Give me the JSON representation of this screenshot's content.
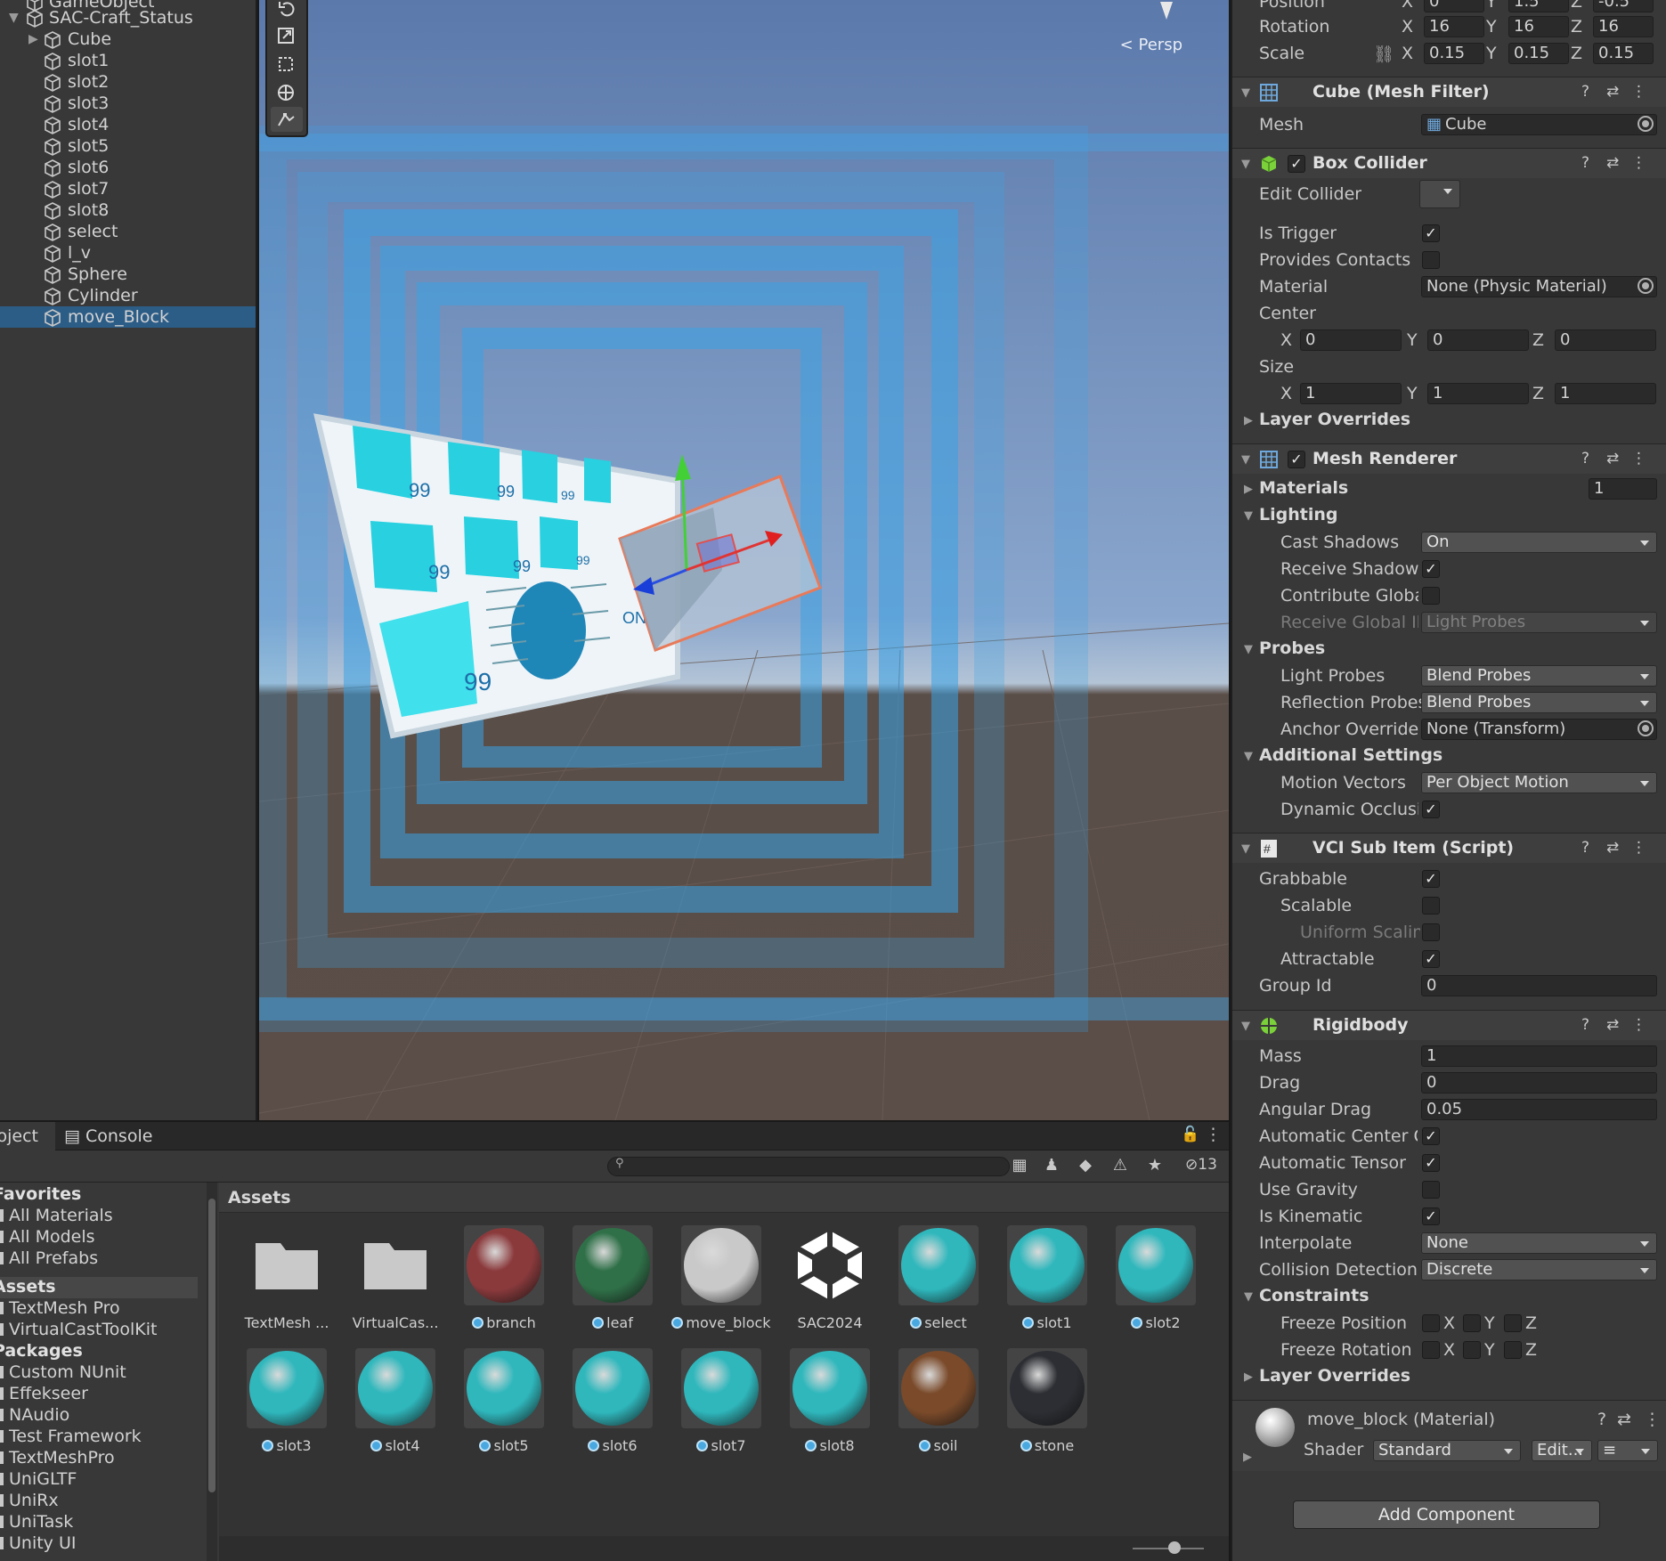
{
  "hierarchy": {
    "items": [
      {
        "label": "GameObject"
      },
      {
        "label": "SAC-Craft_Status"
      },
      {
        "label": "Cube"
      },
      {
        "label": "slot1"
      },
      {
        "label": "slot2"
      },
      {
        "label": "slot3"
      },
      {
        "label": "slot4"
      },
      {
        "label": "slot5"
      },
      {
        "label": "slot6"
      },
      {
        "label": "slot7"
      },
      {
        "label": "slot8"
      },
      {
        "label": "select"
      },
      {
        "label": "l_v"
      },
      {
        "label": "Sphere"
      },
      {
        "label": "Cylinder"
      },
      {
        "label": "move_Block"
      }
    ],
    "selected": "move_Block"
  },
  "scene": {
    "persp_label": "Persp",
    "panel_counts": [
      "99",
      "99",
      "99",
      "99",
      "99",
      "99",
      "99",
      "99",
      "99"
    ],
    "panel_switch": "ON"
  },
  "bottom": {
    "tabs": [
      {
        "label": "Project"
      },
      {
        "label": "Console"
      }
    ],
    "hidden_count": "13",
    "favorites": {
      "title": "Favorites",
      "items": [
        "All Materials",
        "All Models",
        "All Prefabs"
      ]
    },
    "assets_root": {
      "title": "Assets",
      "items": [
        "TextMesh Pro",
        "VirtualCastToolKit"
      ]
    },
    "packages": {
      "title": "Packages",
      "items": [
        "Custom NUnit",
        "Effekseer",
        "NAudio",
        "Test Framework",
        "TextMeshPro",
        "UniGLTF",
        "UniRx",
        "UniTask",
        "Unity UI"
      ]
    },
    "breadcrumb": "Assets",
    "assets": [
      {
        "label": "TextMesh ...",
        "kind": "folder"
      },
      {
        "label": "VirtualCas...",
        "kind": "folder"
      },
      {
        "label": "branch",
        "kind": "material",
        "color": "#8b3a3c"
      },
      {
        "label": "leaf",
        "kind": "material",
        "color": "#2f7048"
      },
      {
        "label": "move_block",
        "kind": "material",
        "color": "#c9c9c9"
      },
      {
        "label": "SAC2024",
        "kind": "unity"
      },
      {
        "label": "select",
        "kind": "material",
        "color": "#2fb7bc"
      },
      {
        "label": "slot1",
        "kind": "material",
        "color": "#2fb7bc"
      },
      {
        "label": "slot2",
        "kind": "material",
        "color": "#2fb7bc"
      },
      {
        "label": "slot3",
        "kind": "material",
        "color": "#2fb7bc"
      },
      {
        "label": "slot4",
        "kind": "material",
        "color": "#2fb7bc"
      },
      {
        "label": "slot5",
        "kind": "material",
        "color": "#2fb7bc"
      },
      {
        "label": "slot6",
        "kind": "material",
        "color": "#2fb7bc"
      },
      {
        "label": "slot7",
        "kind": "material",
        "color": "#2fb7bc"
      },
      {
        "label": "slot8",
        "kind": "material",
        "color": "#2fb7bc"
      },
      {
        "label": "soil",
        "kind": "material",
        "color": "#7a4a2a"
      },
      {
        "label": "stone",
        "kind": "material",
        "color": "#2c2e33"
      }
    ]
  },
  "inspector": {
    "transform": {
      "position_label": "Position",
      "position": {
        "x": "0",
        "y": "1.5",
        "z": "-0.5"
      },
      "rotation_label": "Rotation",
      "rotation": {
        "x": "16",
        "y": "16",
        "z": "16"
      },
      "scale_label": "Scale",
      "scale": {
        "x": "0.15",
        "y": "0.15",
        "z": "0.15"
      }
    },
    "mesh_filter": {
      "title": "Cube (Mesh Filter)",
      "mesh_label": "Mesh",
      "mesh_value": "Cube"
    },
    "box_collider": {
      "title": "Box Collider",
      "edit_label": "Edit Collider",
      "is_trigger_label": "Is Trigger",
      "is_trigger": true,
      "provides_contacts_label": "Provides Contacts",
      "provides_contacts": false,
      "material_label": "Material",
      "material_value": "None (Physic Material)",
      "center_label": "Center",
      "center": {
        "x": "0",
        "y": "0",
        "z": "0"
      },
      "size_label": "Size",
      "size": {
        "x": "1",
        "y": "1",
        "z": "1"
      },
      "layer_overrides": "Layer Overrides"
    },
    "mesh_renderer": {
      "title": "Mesh Renderer",
      "materials_label": "Materials",
      "materials_count": "1",
      "lighting_label": "Lighting",
      "cast_shadows_label": "Cast Shadows",
      "cast_shadows": "On",
      "receive_shadows_label": "Receive Shadows",
      "receive_shadows": true,
      "contribute_gi_label": "Contribute Global",
      "contribute_gi": false,
      "receive_gi_label": "Receive Global Illu",
      "receive_gi": "Light Probes",
      "probes_label": "Probes",
      "light_probes_label": "Light Probes",
      "light_probes": "Blend Probes",
      "reflection_probes_label": "Reflection Probes",
      "reflection_probes": "Blend Probes",
      "anchor_override_label": "Anchor Override",
      "anchor_override": "None (Transform)",
      "additional_label": "Additional Settings",
      "motion_vectors_label": "Motion Vectors",
      "motion_vectors": "Per Object Motion",
      "dynamic_occlusion_label": "Dynamic Occlusion",
      "dynamic_occlusion": true
    },
    "vci_sub_item": {
      "title": "VCI Sub Item (Script)",
      "grabbable_label": "Grabbable",
      "grabbable": true,
      "scalable_label": "Scalable",
      "scalable": false,
      "uniform_label": "Uniform Scaling",
      "uniform": false,
      "attractable_label": "Attractable",
      "attractable": true,
      "group_id_label": "Group Id",
      "group_id": "0"
    },
    "rigidbody": {
      "title": "Rigidbody",
      "mass_label": "Mass",
      "mass": "1",
      "drag_label": "Drag",
      "drag": "0",
      "angular_drag_label": "Angular Drag",
      "angular_drag": "0.05",
      "auto_com_label": "Automatic Center Of",
      "auto_com": true,
      "auto_tensor_label": "Automatic Tensor",
      "auto_tensor": true,
      "use_gravity_label": "Use Gravity",
      "use_gravity": false,
      "is_kinematic_label": "Is Kinematic",
      "is_kinematic": true,
      "interpolate_label": "Interpolate",
      "interpolate": "None",
      "collision_label": "Collision Detection",
      "collision": "Discrete",
      "constraints_label": "Constraints",
      "freeze_pos_label": "Freeze Position",
      "freeze_rot_label": "Freeze Rotation",
      "layer_overrides": "Layer Overrides"
    },
    "material": {
      "title": "move_block (Material)",
      "shader_label": "Shader",
      "shader_value": "Standard",
      "edit_label": "Edit..."
    },
    "add_component": "Add Component"
  }
}
